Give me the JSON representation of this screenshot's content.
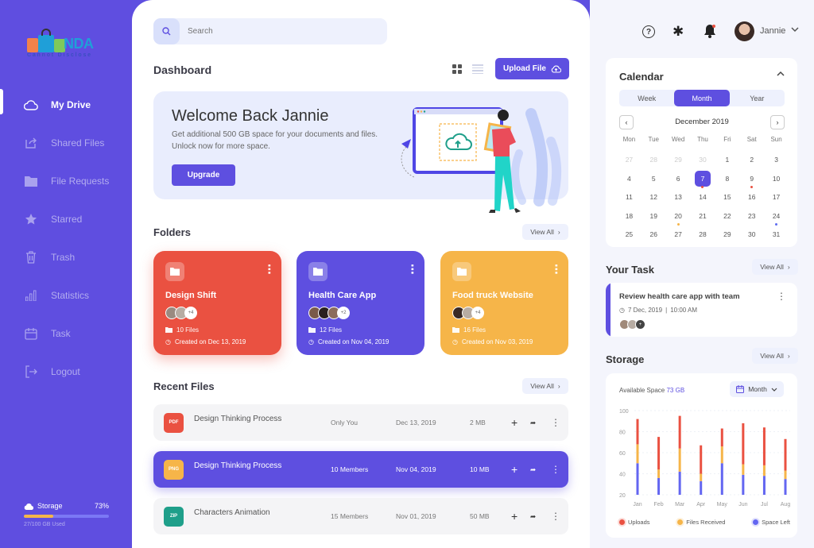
{
  "brand": {
    "logo_word": "NDA",
    "logo_subtitle": "Cannot Disclose"
  },
  "sidebar": {
    "items": [
      {
        "label": "My Drive",
        "icon": "cloud-icon",
        "active": true
      },
      {
        "label": "Shared Files",
        "icon": "share-icon",
        "active": false
      },
      {
        "label": "File Requests",
        "icon": "folder-icon",
        "active": false
      },
      {
        "label": "Starred",
        "icon": "star-icon",
        "active": false
      },
      {
        "label": "Trash",
        "icon": "trash-icon",
        "active": false
      },
      {
        "label": "Statistics",
        "icon": "bar-chart-icon",
        "active": false
      },
      {
        "label": "Task",
        "icon": "calendar-icon",
        "active": false
      },
      {
        "label": "Logout",
        "icon": "logout-icon",
        "active": false
      }
    ],
    "storage": {
      "label": "Storage",
      "percent_label": "73%",
      "used_fraction": 0.35,
      "used_label": "27/100 GB Used"
    }
  },
  "main": {
    "search_placeholder": "Search",
    "title": "Dashboard",
    "upload_label": "Upload File",
    "banner": {
      "title": "Welcome Back Jannie",
      "text": "Get additional 500 GB space for your documents and files. Unlock now for more space.",
      "button": "Upgrade"
    },
    "folders_title": "Folders",
    "view_all": "View All",
    "folders": [
      {
        "name": "Design Shift",
        "more": "+4",
        "files": "10 Files",
        "created": "Created on Dec 13, 2019",
        "color": "#ea5141"
      },
      {
        "name": "Health Care App",
        "more": "+2",
        "files": "12 Files",
        "created": "Created on Nov 04, 2019",
        "color": "#5e4fe0"
      },
      {
        "name": "Food truck Website",
        "more": "+4",
        "files": "16 Files",
        "created": "Created on Nov 03, 2019",
        "color": "#f6b549"
      }
    ],
    "recent_title": "Recent Files",
    "files": [
      {
        "type": "PDF",
        "type_color": "#ea5141",
        "name": "Design Thinking Process",
        "shared": "Only You",
        "date": "Dec 13, 2019",
        "size": "2 MB"
      },
      {
        "type": "PNG",
        "type_color": "#f6b549",
        "name": "Design Thinking Process",
        "shared": "10 Members",
        "date": "Nov 04, 2019",
        "size": "10 MB"
      },
      {
        "type": "ZIP",
        "type_color": "#1f9f8a",
        "name": "Characters Animation",
        "shared": "15 Members",
        "date": "Nov 01, 2019",
        "size": "50 MB"
      }
    ]
  },
  "topbar": {
    "user_name": "Jannie"
  },
  "calendar": {
    "title": "Calendar",
    "tabs": [
      "Week",
      "Month",
      "Year"
    ],
    "active_tab": "Month",
    "month_label": "December 2019",
    "weekdays": [
      "Mon",
      "Tue",
      "Wed",
      "Thu",
      "Fri",
      "Sat",
      "Sun"
    ],
    "days": [
      {
        "d": "27",
        "m": true
      },
      {
        "d": "28",
        "m": true
      },
      {
        "d": "29",
        "m": true
      },
      {
        "d": "30",
        "m": true
      },
      {
        "d": "1"
      },
      {
        "d": "2"
      },
      {
        "d": "3"
      },
      {
        "d": "4"
      },
      {
        "d": "5"
      },
      {
        "d": "6"
      },
      {
        "d": "7",
        "sel": true,
        "dot": "#ea5141"
      },
      {
        "d": "8"
      },
      {
        "d": "9",
        "dot": "#ea5141"
      },
      {
        "d": "10"
      },
      {
        "d": "11"
      },
      {
        "d": "12"
      },
      {
        "d": "13"
      },
      {
        "d": "14"
      },
      {
        "d": "15"
      },
      {
        "d": "16"
      },
      {
        "d": "17"
      },
      {
        "d": "18"
      },
      {
        "d": "19"
      },
      {
        "d": "20",
        "dot": "#f6b549"
      },
      {
        "d": "21"
      },
      {
        "d": "22"
      },
      {
        "d": "23"
      },
      {
        "d": "24",
        "dot": "#5e6cf0"
      },
      {
        "d": "25"
      },
      {
        "d": "26"
      },
      {
        "d": "27"
      },
      {
        "d": "28"
      },
      {
        "d": "29"
      },
      {
        "d": "30"
      },
      {
        "d": "31"
      }
    ]
  },
  "task": {
    "title": "Your Task",
    "view_all": "View All",
    "item": {
      "title": "Review health care app with team",
      "date": "7 Dec, 2019",
      "sep": "|",
      "time": "10:00 AM"
    }
  },
  "storage": {
    "title": "Storage",
    "view_all": "View All",
    "available_label": "Available Space",
    "available_value": "73 GB",
    "period": "Month"
  },
  "chart_data": {
    "type": "bar",
    "stacked": true,
    "categories": [
      "Jan",
      "Feb",
      "Mar",
      "Apr",
      "May",
      "Jun",
      "Jul",
      "Aug"
    ],
    "series": [
      {
        "name": "Space Left",
        "color": "#6366f1",
        "values": [
          30,
          16,
          22,
          13,
          30,
          19,
          18,
          15
        ]
      },
      {
        "name": "Files Received",
        "color": "#f6b549",
        "values": [
          18,
          8,
          22,
          7,
          16,
          10,
          10,
          8
        ]
      },
      {
        "name": "Uploads",
        "color": "#ea5141",
        "values": [
          24,
          31,
          31,
          27,
          17,
          39,
          36,
          30
        ]
      }
    ],
    "y_base": 20,
    "ylim": [
      20,
      100
    ],
    "yticks": [
      100,
      80,
      60,
      40,
      20
    ],
    "grid": true,
    "legend": [
      "Uploads",
      "Files Received",
      "Space Left"
    ],
    "legend_position": "bottom"
  }
}
